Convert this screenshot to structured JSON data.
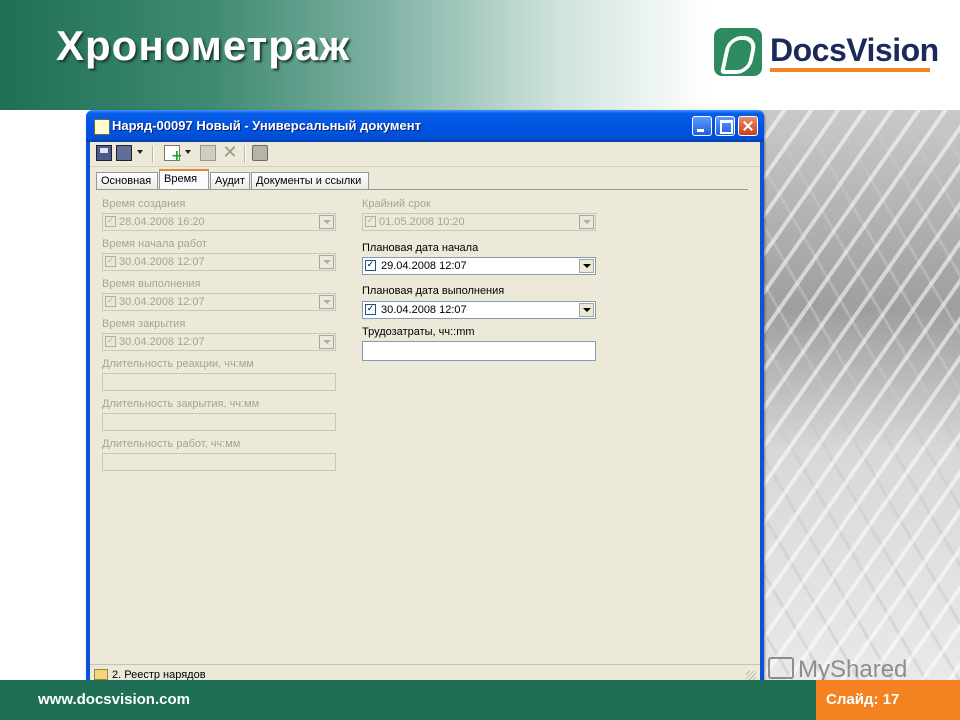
{
  "slide": {
    "title": "Хронометраж",
    "logo_text": "DocsVision",
    "footer_url": "www.docsvision.com",
    "slide_number": "Слайд: 17",
    "watermark": "MyShared",
    "colors": {
      "header_green": "#1f6f56",
      "accent_orange": "#f58220"
    }
  },
  "window": {
    "title": "Наряд-00097 Новый - Универсальный документ",
    "controls": [
      "minimize",
      "maximize",
      "close"
    ]
  },
  "toolbar": {
    "icons": [
      "save-icon",
      "save-all-icon",
      "new-icon",
      "properties-icon",
      "delete-icon",
      "print-icon"
    ]
  },
  "tabs": [
    {
      "label": "Основная"
    },
    {
      "label": "Время",
      "active": true
    },
    {
      "label": "Аудит"
    },
    {
      "label": "Документы и ссылки"
    }
  ],
  "form": {
    "left": {
      "created_label": "Время создания",
      "created_value": "28.04.2008 16:20",
      "start_label": "Время начала работ",
      "start_value": "30.04.2008 12:07",
      "done_label": "Время выполнения",
      "done_value": "30.04.2008 12:07",
      "closed_label": "Время закрытия",
      "closed_value": "30.04.2008 12:07",
      "reaction_label": "Длительность реакции, чч:мм",
      "reaction_value": "",
      "closing_label": "Длительность закрытия, чч:мм",
      "closing_value": "",
      "work_label": "Длительность работ, чч:мм",
      "work_value": ""
    },
    "right": {
      "deadline_label": "Крайний срок",
      "deadline_value": "01.05.2008 10:20",
      "plan_start_label": "Плановая дата начала",
      "plan_start_value": "29.04.2008 12:07",
      "plan_done_label": "Плановая дата выполнения",
      "plan_done_value": "30.04.2008 12:07",
      "labor_label": "Трудозатраты, чч::mm",
      "labor_value": ""
    }
  },
  "statusbar": {
    "text": "2. Реестр нарядов"
  }
}
